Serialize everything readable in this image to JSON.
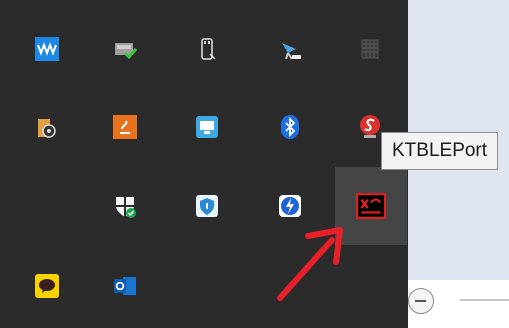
{
  "tooltip": {
    "text": "KTBLEPort"
  },
  "tray_icons": [
    "waves-audio-icon",
    "safely-remove-hardware-icon",
    "usb-drive-icon",
    "network-tower-icon",
    "grid-app-icon",
    "media-app-icon",
    "java-icon",
    "remote-desktop-icon",
    "bluetooth-icon",
    "s-logo-icon",
    "windows-security-icon",
    "shield-check-icon",
    "thunderbolt-icon",
    "ktbleport-icon",
    "kakaotalk-icon",
    "outlook-icon"
  ],
  "colors": {
    "tray_bg": "#2b2b2b",
    "hover_bg": "#454545",
    "arrow": "#e8202a"
  }
}
